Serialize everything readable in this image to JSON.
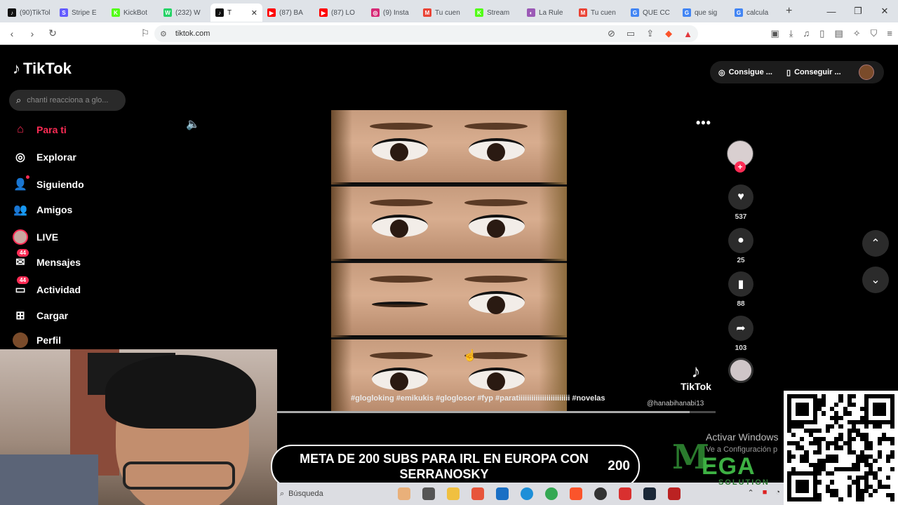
{
  "browser": {
    "tabs": [
      {
        "label": "(90)TikTok",
        "fav_color": "#111111",
        "glyph": "♪"
      },
      {
        "label": "Stripe E",
        "fav_color": "#635bff",
        "glyph": "S"
      },
      {
        "label": "KickBot",
        "fav_color": "#53fc18",
        "glyph": "K"
      },
      {
        "label": "(232) W",
        "fav_color": "#25d366",
        "glyph": "W"
      },
      {
        "label": "T",
        "fav_color": "#111111",
        "glyph": "♪",
        "active": true
      },
      {
        "label": "(87) BA",
        "fav_color": "#ff0000",
        "glyph": "▶"
      },
      {
        "label": "(87) LO",
        "fav_color": "#ff0000",
        "glyph": "▶"
      },
      {
        "label": "(9) Insta",
        "fav_color": "#d62976",
        "glyph": "◎"
      },
      {
        "label": "Tu cuen",
        "fav_color": "#ea4335",
        "glyph": "M"
      },
      {
        "label": "Stream",
        "fav_color": "#53fc18",
        "glyph": "K"
      },
      {
        "label": "La Rule",
        "fav_color": "#9b59b6",
        "glyph": "◐"
      },
      {
        "label": "Tu cuen",
        "fav_color": "#ea4335",
        "glyph": "M"
      },
      {
        "label": "QUE CC",
        "fav_color": "#4285f4",
        "glyph": "G"
      },
      {
        "label": "que sig",
        "fav_color": "#4285f4",
        "glyph": "G"
      },
      {
        "label": "calcula",
        "fav_color": "#4285f4",
        "glyph": "G"
      }
    ],
    "url": "tiktok.com"
  },
  "tiktok": {
    "brand": "TikTok",
    "search_placeholder": "chanti reacciona a glo...",
    "nav": [
      {
        "label": "Para ti",
        "icon": "home-icon",
        "glyph": "⌂",
        "active": true
      },
      {
        "label": "Explorar",
        "icon": "compass-icon",
        "glyph": "◎"
      },
      {
        "label": "Siguiendo",
        "icon": "following-icon",
        "glyph": "👤"
      },
      {
        "label": "Amigos",
        "icon": "friends-icon",
        "glyph": "👥"
      },
      {
        "label": "LIVE",
        "icon": "live-avatar-icon",
        "glyph": ""
      },
      {
        "label": "Mensajes",
        "icon": "messages-icon",
        "glyph": "✉",
        "badge": "44"
      },
      {
        "label": "Actividad",
        "icon": "activity-icon",
        "glyph": "▭",
        "badge": "44"
      },
      {
        "label": "Cargar",
        "icon": "upload-icon",
        "glyph": "⊞"
      },
      {
        "label": "Perfil",
        "icon": "profile-avatar-icon",
        "glyph": "●"
      }
    ],
    "top_buttons": {
      "coins": "Consigue ...",
      "app": "Conseguir ..."
    },
    "video": {
      "hashtags": "#glogloking  #emikukis  #gloglosor  #fyp  #paratiiiiiiiiiiiiiiiiiiiiiiii  #novelas",
      "watermark": "TikTok",
      "handle": "@hanabihanabi13",
      "progress": 0.94
    },
    "actions": {
      "likes": "537",
      "comments": "25",
      "saves": "88",
      "shares": "103"
    }
  },
  "overlay": {
    "banner_text": "META DE 200 SUBS PARA IRL EN EUROPA CON SERRANOSKY",
    "banner_count": "200",
    "activate_title": "Activar Windows",
    "activate_sub": "Ve a Configuración p",
    "logo_word": "EGA",
    "logo_sub": "SOLUTION",
    "taskbar_search": "Búsqueda"
  }
}
